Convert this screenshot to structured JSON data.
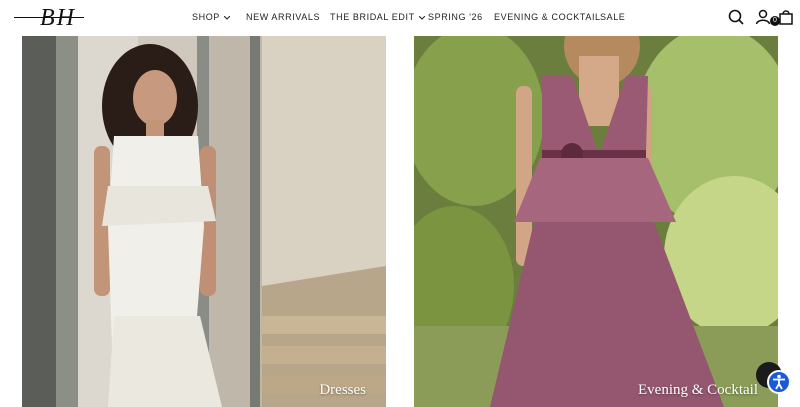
{
  "brand": {
    "logo_text": "BH"
  },
  "nav": {
    "items": [
      {
        "label": "SHOP",
        "has_dropdown": true
      },
      {
        "label": "NEW ARRIVALS",
        "has_dropdown": false
      },
      {
        "label": "THE BRIDAL EDIT",
        "has_dropdown": true
      },
      {
        "label": "SPRING '26",
        "has_dropdown": false
      },
      {
        "label": "EVENING & COCKTAIL",
        "has_dropdown": false
      },
      {
        "label": "SALE",
        "has_dropdown": false
      }
    ]
  },
  "header_icons": {
    "search": "search-icon",
    "account": "user-icon",
    "cart": "bag-icon",
    "cart_count": "0"
  },
  "tiles": [
    {
      "label": "Dresses",
      "image": "bride-in-white-lace-gown"
    },
    {
      "label": "Evening & Cocktail",
      "image": "model-in-mauve-ball-gown"
    }
  ],
  "widgets": {
    "chat": "chat-icon",
    "accessibility": "accessibility-icon"
  },
  "colors": {
    "accessibility_blue": "#1a5ad6",
    "gown_mauve": "#9a5a73"
  }
}
